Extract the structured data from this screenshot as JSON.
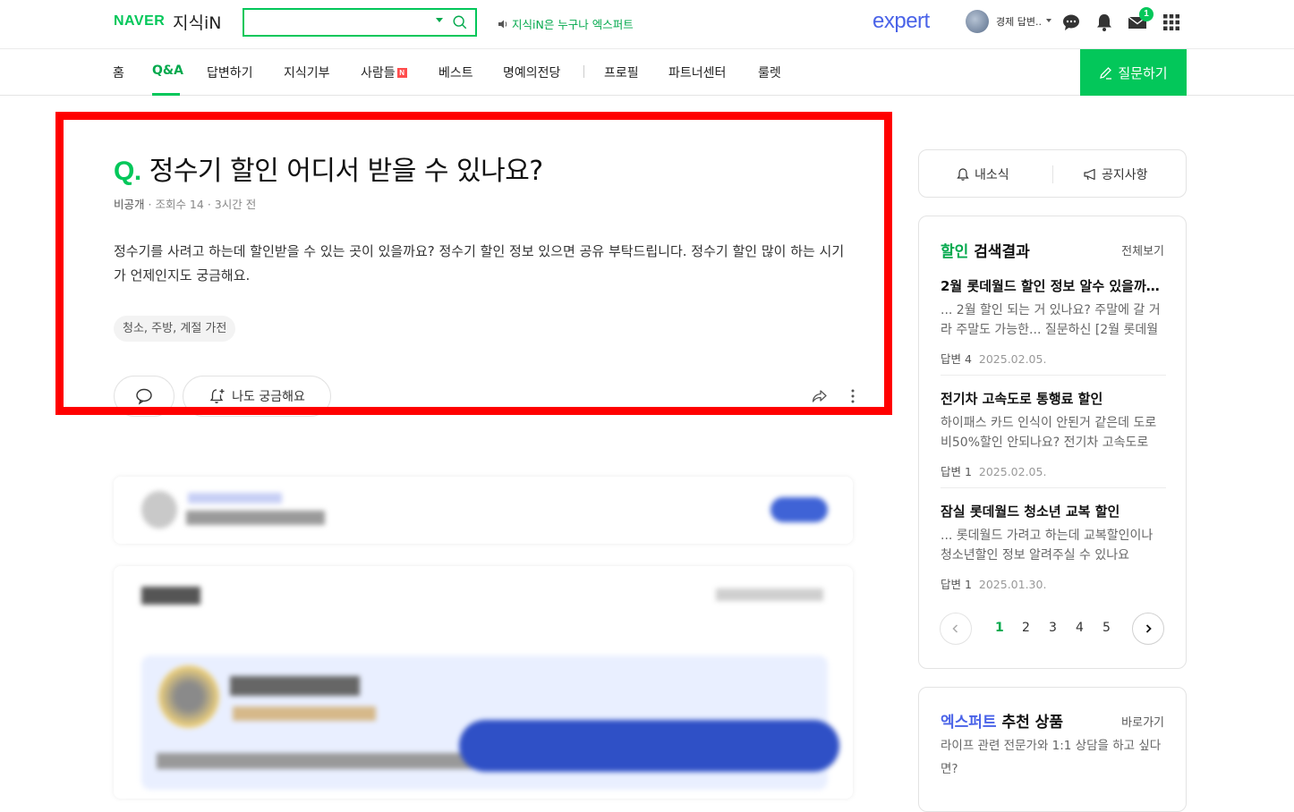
{
  "header": {
    "logo_naver": "NAVER",
    "logo_kin": "지식iN",
    "search": {
      "value": "",
      "placeholder": ""
    },
    "promo_text": "지식iN은 누구나 엑스퍼트",
    "expert_logo": "expert",
    "user_name": "경제 답변..",
    "mail_badge": "1"
  },
  "nav": {
    "items": [
      "홈",
      "Q&A",
      "답변하기",
      "지식기부",
      "사람들",
      "베스트",
      "명예의전당",
      "프로필",
      "파트너센터",
      "룰렛"
    ],
    "active": "Q&A",
    "new_badge": "N",
    "ask_button": "질문하기"
  },
  "question": {
    "q_mark": "Q.",
    "title": "정수기 할인 어디서 받을 수 있나요?",
    "author": "비공개",
    "views": "조회수 14",
    "time": "3시간 전",
    "body": "정수기를 사려고 하는데 할인받을 수 있는 곳이 있을까요? 정수기 할인 정보 있으면 공유 부탁드립니다. 정수기 할인 많이 하는 시기가 언제인지도 궁금해요.",
    "tag": "청소, 주방, 계절 가전",
    "curious_button": "나도 궁금해요"
  },
  "sidebar": {
    "news": "내소식",
    "notice": "공지사항",
    "search_card": {
      "keyword": "할인",
      "title_suffix": " 검색결과",
      "view_all": "전체보기",
      "items": [
        {
          "title": "2월 롯데월드 할인 정보 알수 있을까요?",
          "snippet": "... 2월 할인 되는 거 있나요? 주말에 갈 거라 주말도 가능한... 질문하신 [2월 롯데월드",
          "answers": "답변 4",
          "date": "2025.02.05."
        },
        {
          "title": "전기차 고속도로 통행료 할인",
          "snippet": "하이패스 카드 인식이 안된거 같은데 도로비50%할인 안되나요? 전기차 고속도로",
          "answers": "답변 1",
          "date": "2025.02.05."
        },
        {
          "title": "잠실 롯데월드 청소년 교복 할인",
          "snippet": "... 롯데월드 가려고 하는데 교복할인이나 청소년할인 정보 알려주실 수 있나요",
          "answers": "답변 1",
          "date": "2025.01.30."
        }
      ],
      "pages": [
        "1",
        "2",
        "3",
        "4",
        "5"
      ],
      "current_page": "1"
    },
    "expert_card": {
      "keyword": "엑스퍼트",
      "title_suffix": " 추천 상품",
      "link": "바로가기",
      "desc": "라이프 관련 전문가와 1:1 상담을 하고 싶다면?"
    }
  },
  "colors": {
    "brand_green": "#03c75a",
    "expert_blue": "#4a63e8",
    "highlight_red": "#ff0000"
  }
}
